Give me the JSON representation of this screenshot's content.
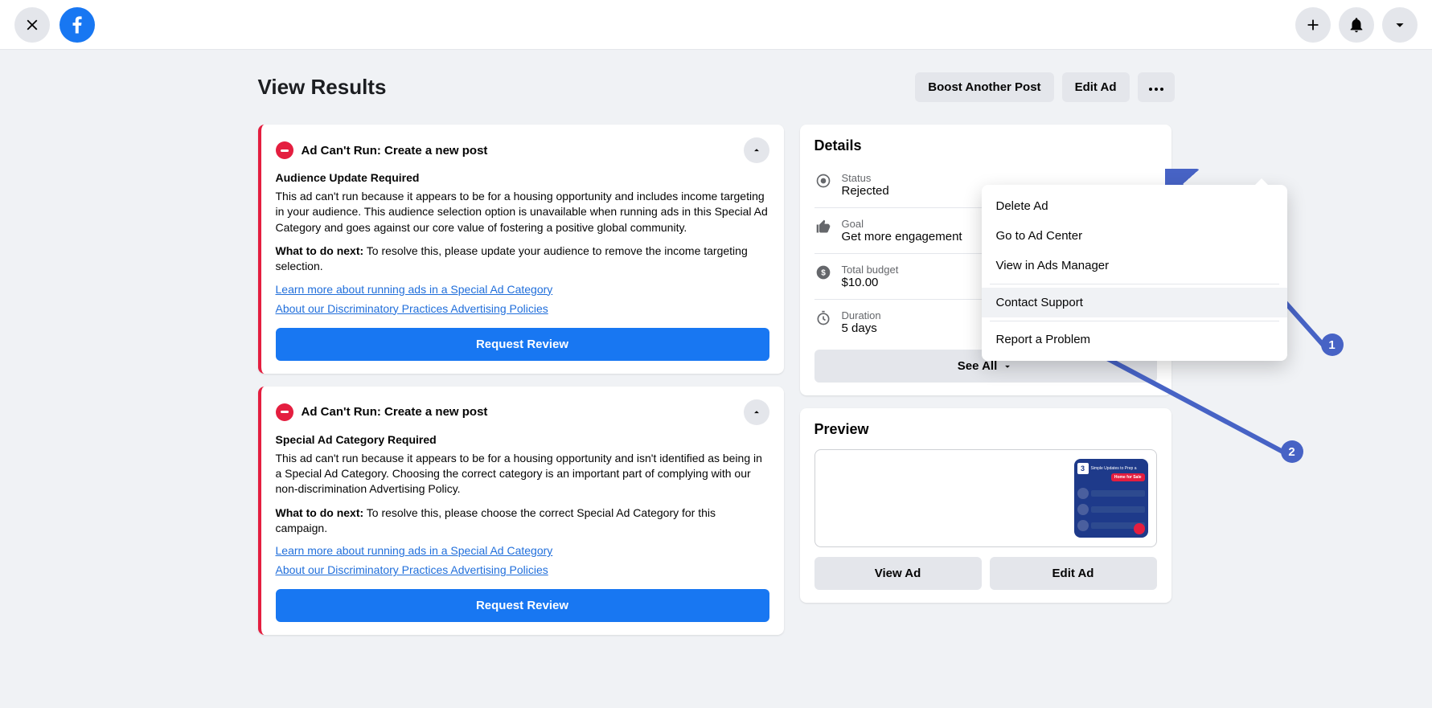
{
  "topbar": {
    "close_label": "Close",
    "fb_label": "f"
  },
  "header": {
    "title": "View Results",
    "boost": "Boost Another Post",
    "edit": "Edit Ad"
  },
  "alerts": [
    {
      "title": "Ad Can't Run: Create a new post",
      "subtitle": "Audience Update Required",
      "body": "This ad can't run because it appears to be for a housing opportunity and includes income targeting in your audience. This audience selection option is unavailable when running ads in this Special Ad Category and goes against our core value of fostering a positive global community.",
      "next_label": "What to do next:",
      "next_text": " To resolve this, please update your audience to remove the income targeting selection.",
      "link1": "Learn more about running ads in a Special Ad Category",
      "link2": "About our Discriminatory Practices Advertising Policies",
      "button": "Request Review"
    },
    {
      "title": "Ad Can't Run: Create a new post",
      "subtitle": "Special Ad Category Required",
      "body": "This ad can't run because it appears to be for a housing opportunity and isn't identified as being in a Special Ad Category. Choosing the correct category is an important part of complying with our non-discrimination Advertising Policy.",
      "next_label": "What to do next:",
      "next_text": " To resolve this, please choose the correct Special Ad Category for this campaign.",
      "link1": "Learn more about running ads in a Special Ad Category",
      "link2": "About our Discriminatory Practices Advertising Policies",
      "button": "Request Review"
    }
  ],
  "details": {
    "heading": "Details",
    "status_label": "Status",
    "status_value": "Rejected",
    "goal_label": "Goal",
    "goal_value": "Get more engagement",
    "budget_label": "Total budget",
    "budget_value": "$10.00",
    "duration_label": "Duration",
    "duration_value": "5 days",
    "see_all": "See All"
  },
  "preview": {
    "heading": "Preview",
    "thumb_num": "3",
    "thumb_head": "Simple Updates to Prep a",
    "thumb_pill": "Home for Sale",
    "view": "View Ad",
    "edit": "Edit Ad"
  },
  "dropdown": {
    "delete": "Delete Ad",
    "adcenter": "Go to Ad Center",
    "adsmanager": "View in Ads Manager",
    "contact": "Contact Support",
    "report": "Report a Problem"
  },
  "annotations": {
    "n1": "1",
    "n2": "2"
  }
}
